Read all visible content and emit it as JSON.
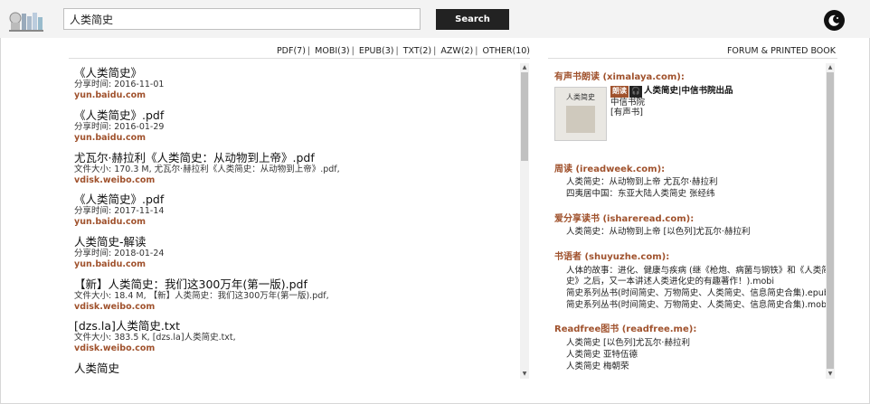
{
  "search": {
    "value": "人类简史",
    "button_label": "Search"
  },
  "filters": [
    {
      "label": "PDF(7)"
    },
    {
      "label": "MOBI(3)"
    },
    {
      "label": "EPUB(3)"
    },
    {
      "label": "TXT(2)"
    },
    {
      "label": "AZW(2)"
    },
    {
      "label": "OTHER(10)"
    }
  ],
  "forum_link": "FORUM & PRINTED BOOK",
  "results": [
    {
      "title": "《人类简史》",
      "meta": "分享时间: 2016-11-01",
      "source": "yun.baidu.com"
    },
    {
      "title": "《人类简史》.pdf",
      "meta": "分享时间: 2016-01-29",
      "source": "yun.baidu.com"
    },
    {
      "title": "尤瓦尔·赫拉利《人类简史：从动物到上帝》.pdf",
      "meta": "文件大小: 170.3 M, 尤瓦尔·赫拉利《人类简史：从动物到上帝》.pdf,",
      "source": "vdisk.weibo.com"
    },
    {
      "title": "《人类简史》.pdf",
      "meta": "分享时间: 2017-11-14",
      "source": "yun.baidu.com"
    },
    {
      "title": "人类简史-解读",
      "meta": "分享时间: 2018-01-24",
      "source": "yun.baidu.com"
    },
    {
      "title": "【新】人类简史：我们这300万年(第一版).pdf",
      "meta": "文件大小: 18.4 M, 【新】人类简史：我们这300万年(第一版).pdf,",
      "source": "vdisk.weibo.com"
    },
    {
      "title": "[dzs.la]人类简史.txt",
      "meta": "文件大小: 383.5 K, [dzs.la]人类简史.txt,",
      "source": "vdisk.weibo.com"
    },
    {
      "title": "人类简史",
      "meta": "",
      "source": ""
    }
  ],
  "sidebar": {
    "ximalaya": {
      "title": "有声书朗读 (ximalaya.com):",
      "badge1": "朗读",
      "badge2": "🎧",
      "book_title": "人类简史|中信书院出品",
      "publisher": "中信书院",
      "tag": "[有声书]",
      "cover_text": "人类简史"
    },
    "ireadweek": {
      "title": "周读 (ireadweek.com):",
      "items": [
        "人类简史：从动物到上帝 尤瓦尔·赫拉利",
        "四夷居中国：东亚大陆人类简史 张经纬"
      ]
    },
    "ishareread": {
      "title": "爱分享读书 (ishareread.com):",
      "items": [
        "人类简史：从动物到上帝 [以色列]尤瓦尔·赫拉利"
      ]
    },
    "shuyuzhe": {
      "title": "书语者 (shuyuzhe.com):",
      "items": [
        "人体的故事：进化、健康与疾病 (继《枪炮、病菌与钢铁》和《人类简",
        "史》之后，又一本讲述人类进化史的有趣著作！).mobi",
        "简史系列丛书(时间简史、万物简史、人类简史、信息简史合集).epub",
        "简史系列丛书(时间简史、万物简史、人类简史、信息简史合集).mobi"
      ]
    },
    "readfree": {
      "title": "Readfree图书 (readfree.me):",
      "items": [
        "人类简史 [以色列]尤瓦尔·赫拉利",
        "人类简史 亚特伍德",
        "人类简史 梅朝荣"
      ]
    }
  }
}
